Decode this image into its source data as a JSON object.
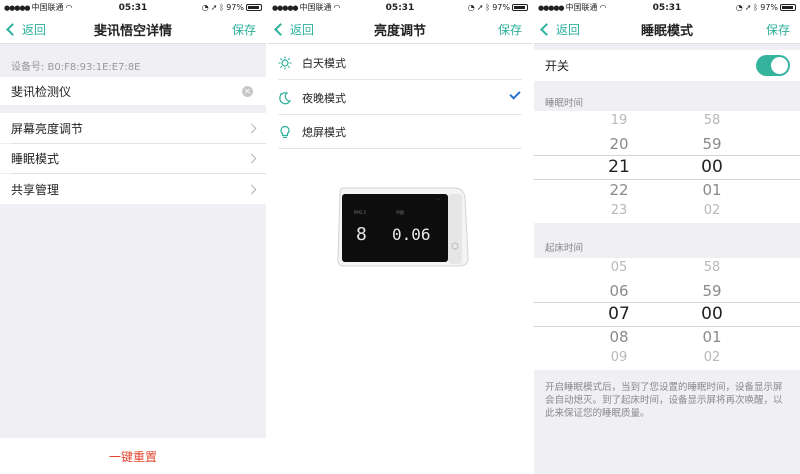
{
  "status": {
    "carrier": "中国联通",
    "time": "05:31",
    "battery": "97%"
  },
  "screen1": {
    "back_label": "返回",
    "title": "斐讯悟空详情",
    "save_label": "保存",
    "device_id": "设备号: B0:F8:93:1E:E7:8E",
    "device_name_value": "斐讯检测仪",
    "menu": [
      {
        "label": "屏幕亮度调节"
      },
      {
        "label": "睡眠模式"
      },
      {
        "label": "共享管理"
      }
    ],
    "reset_label": "一键重置"
  },
  "screen2": {
    "back_label": "返回",
    "title": "亮度调节",
    "save_label": "保存",
    "modes": [
      {
        "label": "白天模式",
        "icon": "sun-icon",
        "selected": false
      },
      {
        "label": "夜晚模式",
        "icon": "moon-icon",
        "selected": true
      },
      {
        "label": "熄屏模式",
        "icon": "bulb-icon",
        "selected": false
      }
    ],
    "device_display": {
      "left_value": "8",
      "right_value": "0.06",
      "left_label": "PM2.5",
      "right_label": "甲醛"
    }
  },
  "screen3": {
    "back_label": "返回",
    "title": "睡眠模式",
    "save_label": "保存",
    "switch_label": "开关",
    "switch_on": true,
    "sleep_label": "睡眠时间",
    "sleep_hours": [
      "19",
      "20",
      "21",
      "22",
      "23"
    ],
    "sleep_minutes": [
      "58",
      "59",
      "00",
      "01",
      "02"
    ],
    "wake_label": "起床时间",
    "wake_hours": [
      "05",
      "06",
      "07",
      "08",
      "09"
    ],
    "wake_minutes": [
      "58",
      "59",
      "00",
      "01",
      "02"
    ],
    "note": "开启睡眠模式后，当到了您设置的睡眠时间，设备显示屏会自动熄灭。到了起床时间，设备显示屏将再次唤醒，以此来保证您的睡眠质量。"
  },
  "colors": {
    "accent": "#2bb09b",
    "danger": "#e4452f",
    "check": "#2a74d4"
  }
}
